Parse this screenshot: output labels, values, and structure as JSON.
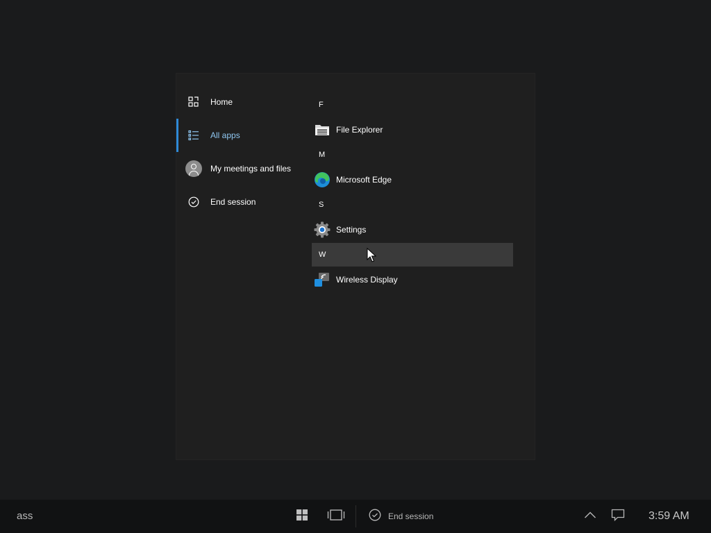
{
  "nav": {
    "items": [
      {
        "label": "Home",
        "icon": "home-grid-icon",
        "selected": false
      },
      {
        "label": "All apps",
        "icon": "list-icon",
        "selected": true
      },
      {
        "label": "My meetings and files",
        "icon": "avatar-icon",
        "selected": false
      },
      {
        "label": "End session",
        "icon": "checkmark-circle-icon",
        "selected": false
      }
    ]
  },
  "apps": {
    "groups": [
      {
        "letter": "F",
        "items": [
          {
            "label": "File Explorer",
            "icon": "file-explorer-icon"
          }
        ]
      },
      {
        "letter": "M",
        "items": [
          {
            "label": "Microsoft Edge",
            "icon": "edge-icon"
          }
        ]
      },
      {
        "letter": "S",
        "items": [
          {
            "label": "Settings",
            "icon": "settings-gear-icon"
          }
        ]
      },
      {
        "letter": "W",
        "items": [
          {
            "label": "Wireless Display",
            "icon": "wireless-display-icon"
          }
        ],
        "hovered": true
      }
    ]
  },
  "taskbar": {
    "search_text": "ass",
    "end_session_label": "End session",
    "clock": "3:59 AM"
  },
  "colors": {
    "accent": "#2e8ad8",
    "selected_text": "#8fc6f0",
    "menu_bg": "#1f1f1f",
    "hover_bg": "#3a3a3a",
    "taskbar_bg": "#111213"
  }
}
